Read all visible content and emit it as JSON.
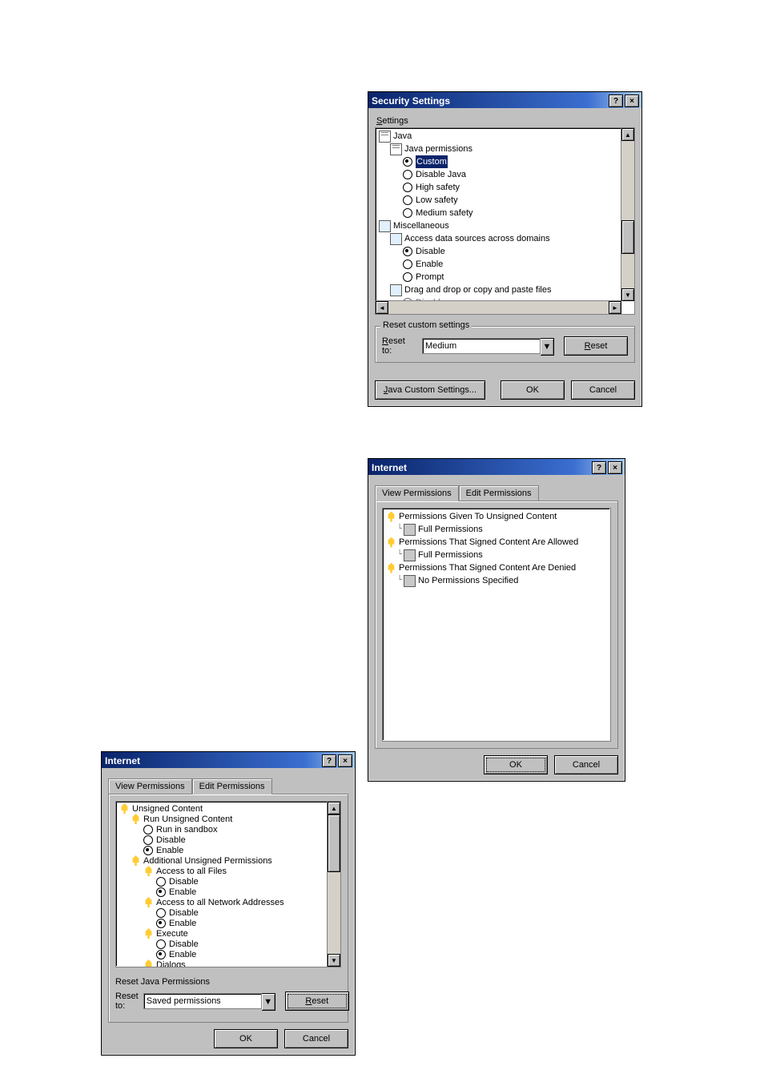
{
  "dialog1": {
    "title": "Security Settings",
    "settings_label": "Settings",
    "tree": {
      "java": "Java",
      "java_permissions": "Java permissions",
      "opt_custom": "Custom",
      "opt_disable_java": "Disable Java",
      "opt_high_safety": "High safety",
      "opt_low_safety": "Low safety",
      "opt_medium_safety": "Medium safety",
      "misc": "Miscellaneous",
      "access_data": "Access data sources across domains",
      "opt_ad_disable": "Disable",
      "opt_ad_enable": "Enable",
      "opt_ad_prompt": "Prompt",
      "dragdrop": "Drag and drop or copy and paste files",
      "opt_dd_disable": "Disable"
    },
    "reset_group_title": "Reset custom settings",
    "reset_to_label": "Reset to:",
    "reset_to_value": "Medium",
    "btn_reset": "Reset",
    "btn_java_custom": "Java Custom Settings...",
    "btn_ok": "OK",
    "btn_cancel": "Cancel"
  },
  "dialog2": {
    "title": "Internet",
    "tab_view": "View Permissions",
    "tab_edit": "Edit Permissions",
    "tree": {
      "unsigned_header": "Permissions Given To Unsigned Content",
      "unsigned_value": "Full Permissions",
      "signed_allowed_header": "Permissions That Signed Content Are Allowed",
      "signed_allowed_value": "Full Permissions",
      "signed_denied_header": "Permissions That Signed Content Are Denied",
      "signed_denied_value": "No Permissions Specified"
    },
    "btn_ok": "OK",
    "btn_cancel": "Cancel"
  },
  "dialog3": {
    "title": "Internet",
    "tab_view": "View Permissions",
    "tab_edit": "Edit Permissions",
    "tree": {
      "unsigned_content": "Unsigned Content",
      "run_unsigned": "Run Unsigned Content",
      "opt_sandbox": "Run in sandbox",
      "opt_disable": "Disable",
      "opt_enable": "Enable",
      "additional_perm": "Additional Unsigned Permissions",
      "access_files": "Access to all Files",
      "opt_af_disable": "Disable",
      "opt_af_enable": "Enable",
      "access_net": "Access to all Network Addresses",
      "opt_an_disable": "Disable",
      "opt_an_enable": "Enable",
      "execute": "Execute",
      "opt_ex_disable": "Disable",
      "opt_ex_enable": "Enable",
      "dialogs": "Dialogs"
    },
    "reset_group_title": "Reset Java Permissions",
    "reset_to_label": "Reset to:",
    "reset_to_value": "Saved permissions",
    "btn_reset": "Reset",
    "btn_ok": "OK",
    "btn_cancel": "Cancel"
  }
}
